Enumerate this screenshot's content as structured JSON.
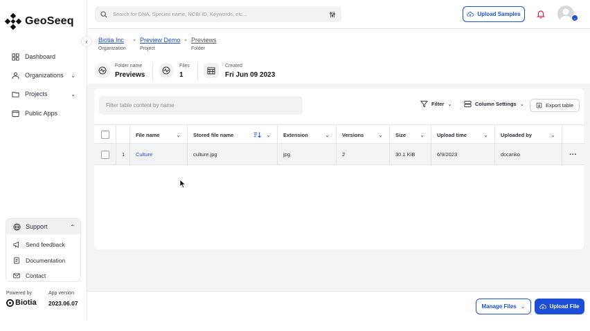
{
  "app": {
    "name": "GeoSeeq",
    "brand_color": "#1d4ed8",
    "accent_color": "#e11d48"
  },
  "sidebar": {
    "items": [
      {
        "label": "Dashboard",
        "icon": "dashboard-icon"
      },
      {
        "label": "Organizations",
        "icon": "organization-icon",
        "expandable": true
      },
      {
        "label": "Projects",
        "icon": "folder-icon",
        "expandable": true
      },
      {
        "label": "Public Apps",
        "icon": "apps-icon"
      }
    ],
    "support": {
      "label": "Support",
      "items": [
        {
          "label": "Send feedback",
          "icon": "megaphone-icon"
        },
        {
          "label": "Documentation",
          "icon": "document-icon"
        },
        {
          "label": "Contact",
          "icon": "mail-icon"
        }
      ]
    },
    "footer": {
      "powered_by": "Powered by",
      "powered_brand": "Biotia",
      "app_version_label": "App version",
      "app_version": "2023.06.07"
    }
  },
  "header": {
    "search_placeholder": "Search for DNA, Species name, NCBI ID, Keywords, etc...",
    "upload_samples": "Upload Samples"
  },
  "breadcrumb": [
    {
      "label": "Biotia Inc",
      "type": "Organization"
    },
    {
      "label": "Preview Demo",
      "type": "Project"
    },
    {
      "label": "Previews",
      "type": "Folder"
    }
  ],
  "folder_info": {
    "name_label": "Folder name",
    "name_value": "Previews",
    "files_label": "Files",
    "files_value": "1",
    "created_label": "Created",
    "created_value": "Fri Jun 09 2023"
  },
  "table": {
    "filter_placeholder": "Filter table content by name",
    "filter_button": "Filter",
    "column_settings_button": "Column Settings",
    "export_button": "Export table",
    "columns": [
      "File name",
      "Stored file name",
      "Extension",
      "Versions",
      "Size",
      "Upload time",
      "Uploaded by"
    ],
    "rows": [
      {
        "index": "1",
        "file_name": "Culture",
        "stored_file_name": "culture.jpg",
        "extension": "jpg",
        "versions": "2",
        "size": "30.1 KiB",
        "upload_time": "6/9/2023",
        "uploaded_by": "dccanko"
      }
    ],
    "row_actions": "···"
  },
  "footer_actions": {
    "manage_files": "Manage Files",
    "upload_file": "Upload File"
  }
}
